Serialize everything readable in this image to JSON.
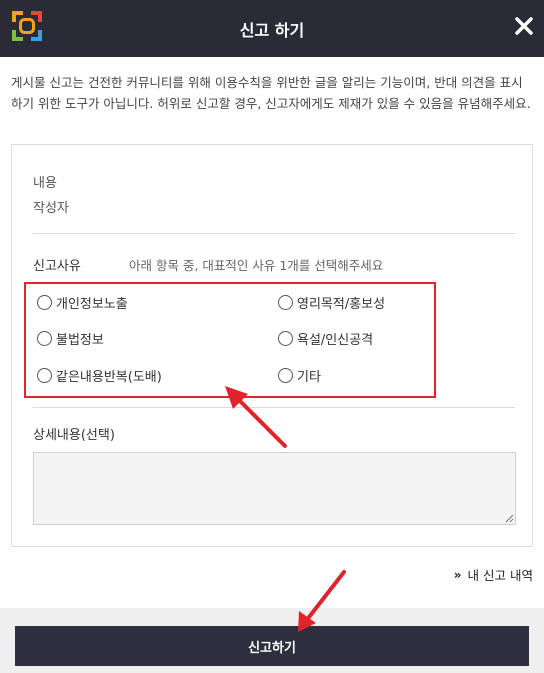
{
  "header": {
    "title": "신고 하기",
    "logo_icon": "app-logo-icon",
    "close_icon": "close-icon"
  },
  "notice": "게시물 신고는 건전한 커뮤니티를 위해 이용수칙을 위반한 글을 알리는 기능이며, 반대 의견을 표시하기 위한 도구가 아닙니다. 허위로 신고할 경우, 신고자에게도 제재가 있을 수 있음을 유념해주세요.",
  "post_info": {
    "content_label": "내용",
    "author_label": "작성자"
  },
  "reason": {
    "title": "신고사유",
    "hint": "아래 항목 중, 대표적인 사유 1개를 선택해주세요",
    "options": [
      "개인정보노출",
      "영리목적/홍보성",
      "불법정보",
      "욕설/인신공격",
      "같은내용반복(도배)",
      "기타"
    ]
  },
  "detail": {
    "title": "상세내용(선택)",
    "value": ""
  },
  "history_link": "내 신고 내역",
  "submit_label": "신고하기",
  "colors": {
    "header_bg": "#2b2b38",
    "submit_bg": "#2f2f3f",
    "annotation_red": "#e0242b"
  }
}
